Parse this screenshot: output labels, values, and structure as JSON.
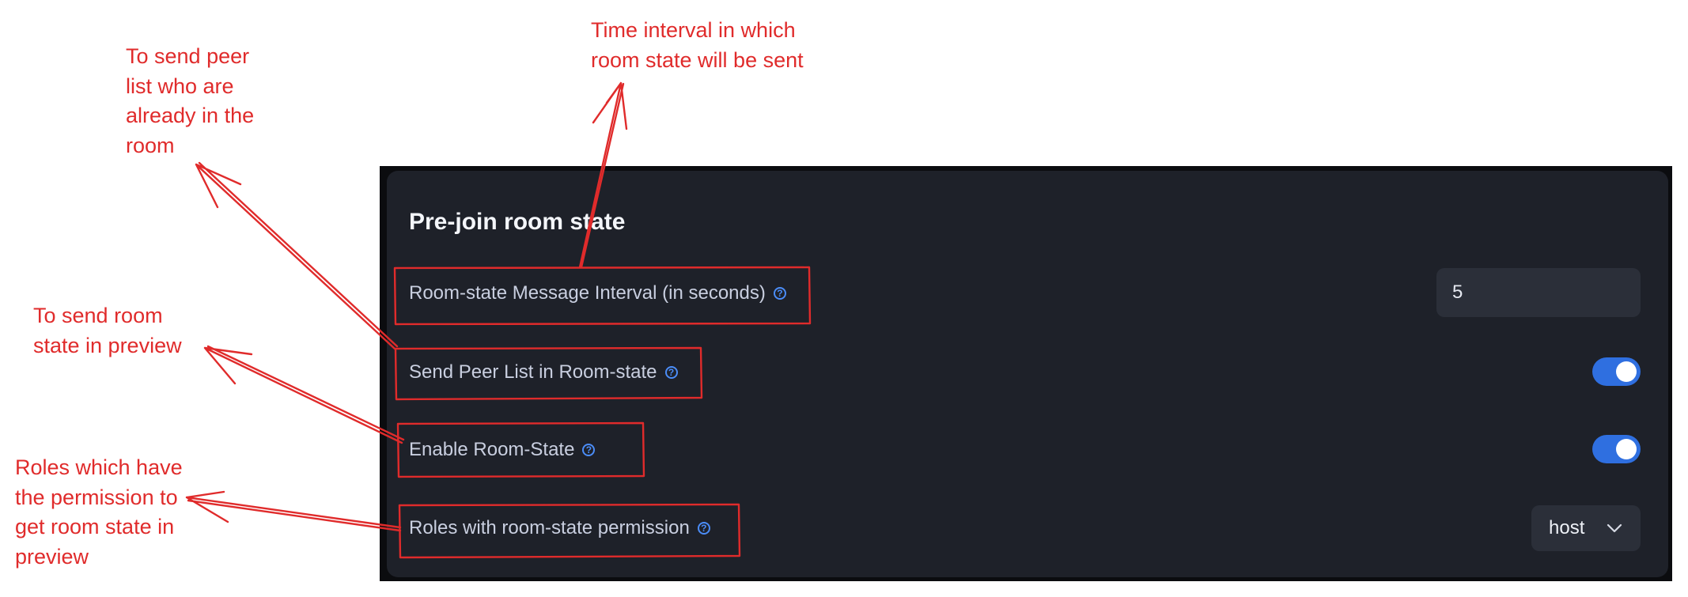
{
  "panel": {
    "title": "Pre-join room state",
    "rows": [
      {
        "label": "Room-state Message Interval (in seconds)",
        "control": "input",
        "value": "5"
      },
      {
        "label": "Send Peer List in Room-state",
        "control": "toggle",
        "enabled": true
      },
      {
        "label": "Enable Room-State",
        "control": "toggle",
        "enabled": true
      },
      {
        "label": "Roles with room-state permission",
        "control": "select",
        "selected": "host"
      }
    ]
  },
  "annotations": {
    "time_interval": [
      "Time interval in which",
      "room state will be sent"
    ],
    "peer_list": [
      "To send peer",
      "list who are",
      "already in the",
      "room"
    ],
    "room_state_preview": [
      "To send room",
      "state in preview"
    ],
    "roles": [
      "Roles which have",
      "the permission to",
      "get room state in",
      "preview"
    ]
  },
  "colors": {
    "annotation": "#e02b2b",
    "panel_background": "#1e2129",
    "toggle_on": "#2f6fe0",
    "help_icon": "#4b8df8"
  },
  "icons": {
    "help": "question-circle-icon",
    "dropdown": "chevron-down-icon"
  }
}
